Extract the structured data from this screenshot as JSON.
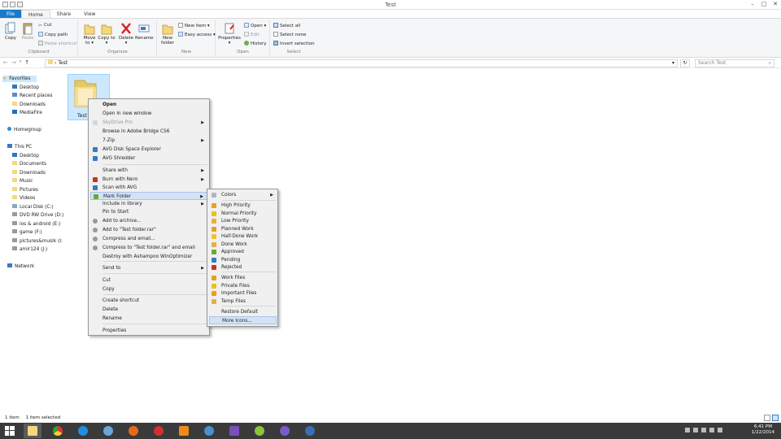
{
  "window": {
    "title": "Test",
    "controls": [
      "–",
      "□",
      "✕"
    ]
  },
  "tabs": [
    {
      "label": "File"
    },
    {
      "label": "Home"
    },
    {
      "label": "Share"
    },
    {
      "label": "View"
    }
  ],
  "ribbon": {
    "clipboard": {
      "label": "Clipboard",
      "copy": "Copy",
      "paste": "Paste",
      "cut": "Cut",
      "copy_path": "Copy path",
      "paste_shortcut": "Paste shortcut"
    },
    "organize": {
      "label": "Organize",
      "move_to": "Move to",
      "copy_to": "Copy to",
      "delete": "Delete",
      "rename": "Rename"
    },
    "new": {
      "label": "New",
      "new_folder": "New folder",
      "new_item": "New item",
      "easy_access": "Easy access"
    },
    "open": {
      "label": "Open",
      "properties": "Properties",
      "open": "Open",
      "edit": "Edit",
      "history": "History"
    },
    "select": {
      "label": "Select",
      "select_all": "Select all",
      "select_none": "Select none",
      "invert": "Invert selection"
    }
  },
  "address": {
    "path": "Test",
    "search_placeholder": "Search Test"
  },
  "nav": {
    "favorites": "Favorites",
    "fav_items": [
      "Desktop",
      "Recent places",
      "Downloads",
      "MediaFire"
    ],
    "homegroup": "Homegroup",
    "thispc": "This PC",
    "pc_items": [
      "Desktop",
      "Documents",
      "Downloads",
      "Music",
      "Pictures",
      "Videos",
      "Local Disk (C:)",
      "DVD RW Drive (D:)",
      "ios & android (E:)",
      "game (F:)",
      "pictures&musik (I:",
      "amir124 (J:)"
    ],
    "network": "Network"
  },
  "content": {
    "folder_name": "Test"
  },
  "context_menu": [
    {
      "label": "Open",
      "bold": true
    },
    {
      "label": "Open in new window"
    },
    {
      "label": "SkyDrive Pro",
      "disabled": true,
      "submenu": true
    },
    {
      "label": "Browse in Adobe Bridge CS6"
    },
    {
      "label": "7-Zip",
      "submenu": true
    },
    {
      "label": "AVG Disk Space Explorer"
    },
    {
      "label": "AVG Shredder"
    },
    {
      "label": "Share with",
      "submenu": true
    },
    {
      "label": "Burn with Nero",
      "submenu": true
    },
    {
      "label": "Scan with AVG"
    },
    {
      "label": "Mark Folder",
      "submenu": true,
      "selected": true
    },
    {
      "label": "Include in library",
      "submenu": true
    },
    {
      "label": "Pin to Start"
    },
    {
      "label": "Add to archive..."
    },
    {
      "label": "Add to \"Test folder.rar\""
    },
    {
      "label": "Compress and email..."
    },
    {
      "label": "Compress to \"Test folder.rar\" and email"
    },
    {
      "label": "Destroy with Ashampoo WinOptimizer"
    },
    {
      "label": "Send to",
      "submenu": true
    },
    {
      "label": "Cut"
    },
    {
      "label": "Copy"
    },
    {
      "label": "Create shortcut"
    },
    {
      "label": "Delete"
    },
    {
      "label": "Rename"
    },
    {
      "label": "Properties"
    }
  ],
  "submenu": [
    {
      "label": "Colors",
      "submenu": true
    },
    {
      "label": "High Priority"
    },
    {
      "label": "Normal Priority"
    },
    {
      "label": "Low Priority"
    },
    {
      "label": "Planned Work"
    },
    {
      "label": "Half-Done Work"
    },
    {
      "label": "Done Work"
    },
    {
      "label": "Approved"
    },
    {
      "label": "Pending"
    },
    {
      "label": "Rejected"
    },
    {
      "label": "Work Files"
    },
    {
      "label": "Private Files"
    },
    {
      "label": "Important Files"
    },
    {
      "label": "Temp Files"
    },
    {
      "label": "Restore Default"
    },
    {
      "label": "More Icons...",
      "selected": true
    }
  ],
  "status": {
    "count": "1 item",
    "selected": "1 item selected"
  },
  "clock": {
    "time": "6:41 PM",
    "date": "1/22/2014"
  },
  "colors": {
    "file_tab": "#1979ca",
    "selection": "#cce8ff",
    "taskbar": "#3a3a3a",
    "folder": "#f4d77e"
  }
}
